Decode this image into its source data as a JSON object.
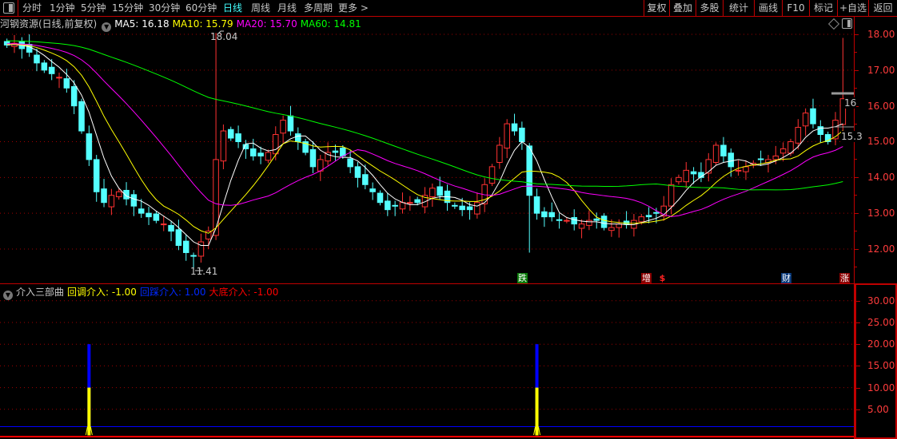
{
  "toolbar": {
    "periods": [
      "分时",
      "1分钟",
      "5分钟",
      "15分钟",
      "30分钟",
      "60分钟",
      "日线",
      "周线",
      "月线",
      "多周期",
      "更多 >"
    ],
    "active_period": "日线",
    "right_buttons": [
      "复权",
      "叠加",
      "多股",
      "统计",
      "画线",
      "F10",
      "标记",
      "+自选",
      "返回"
    ]
  },
  "main_header": {
    "title": "河钢资源(日线,前复权)",
    "ma5": "MA5: 16.18",
    "ma10": "MA10: 15.79",
    "ma20": "MA20: 15.70",
    "ma60": "MA60: 14.81"
  },
  "indicator_header": {
    "name": "介入三部曲",
    "s1": "回调介入: -1.00",
    "s2": "回踩介入: 1.00",
    "s3": "大底介入: -1.00"
  },
  "colors": {
    "up": "#ff3232",
    "down": "#54ffff",
    "ma5": "#ffffff",
    "ma10": "#ffff00",
    "ma20": "#ff00ff",
    "ma60": "#00ff00",
    "grid": "#a00000",
    "axis": "#ff3c3c"
  },
  "annotations": {
    "high": "18.04",
    "low": "11.41",
    "last_high": "16",
    "last_low": "15.3"
  },
  "markers": [
    {
      "text": "跌",
      "bg": "#0a7a0a"
    },
    {
      "text": "增",
      "bg": "#8a0000"
    },
    {
      "text": "$",
      "bg": ""
    },
    {
      "text": "财",
      "bg": "#0a3a7a"
    },
    {
      "text": "涨",
      "bg": "#8a0000"
    }
  ],
  "chart_data": [
    {
      "type": "candlestick",
      "title": "河钢资源 日线",
      "ylim": [
        11.3,
        18.2
      ],
      "yticks": [
        "18.00",
        "17.00",
        "16.00",
        "15.00",
        "14.00",
        "13.00",
        "12.00"
      ],
      "closes": [
        17.7,
        17.75,
        17.6,
        17.5,
        17.2,
        17.0,
        16.9,
        16.8,
        16.5,
        16.0,
        15.3,
        14.5,
        13.6,
        13.3,
        13.5,
        13.6,
        13.4,
        13.2,
        13.0,
        12.9,
        12.8,
        12.7,
        12.5,
        12.1,
        11.9,
        11.8,
        12.2,
        12.5,
        14.5,
        15.3,
        15.1,
        15.0,
        14.8,
        14.6,
        14.6,
        14.7,
        15.2,
        15.6,
        15.3,
        15.0,
        14.7,
        14.3,
        14.5,
        14.7,
        14.7,
        14.6,
        14.3,
        14.0,
        13.8,
        13.6,
        13.3,
        13.1,
        13.2,
        13.3,
        13.3,
        13.3,
        13.5,
        13.7,
        13.5,
        13.3,
        13.2,
        13.1,
        13.1,
        13.3,
        13.8,
        14.3,
        14.9,
        15.5,
        15.3,
        15.0,
        13.5,
        13.0,
        12.9,
        12.9,
        12.8,
        12.8,
        12.7,
        12.7,
        12.8,
        12.8,
        12.6,
        12.6,
        12.7,
        12.7,
        12.8,
        12.9,
        12.9,
        13.0,
        13.2,
        13.8,
        14.0,
        14.2,
        14.1,
        14.0,
        14.5,
        14.9,
        14.6,
        14.3,
        14.2,
        14.3,
        14.4,
        14.5,
        14.5,
        14.6,
        14.8,
        15.0,
        15.4,
        15.8,
        15.5,
        15.2,
        15.0,
        15.6,
        16.2
      ]
    },
    {
      "type": "bar",
      "title": "介入三部曲",
      "ylim": [
        -1,
        32
      ],
      "yticks": [
        "30.00",
        "25.00",
        "20.00",
        "15.00",
        "10.00",
        "5.00"
      ],
      "series": [
        {
          "name": "回调介入",
          "color": "#ffff00",
          "bars": [
            {
              "index": 11,
              "value": 10
            },
            {
              "index": 71,
              "value": 10
            }
          ],
          "baseline": -1
        },
        {
          "name": "回踩介入",
          "color": "#0000ff",
          "bars": [
            {
              "index": 11,
              "value": 20
            },
            {
              "index": 71,
              "value": 20
            }
          ],
          "baseline": 1
        },
        {
          "name": "大底介入",
          "color": "#ff0000",
          "baseline": -1
        }
      ]
    }
  ]
}
